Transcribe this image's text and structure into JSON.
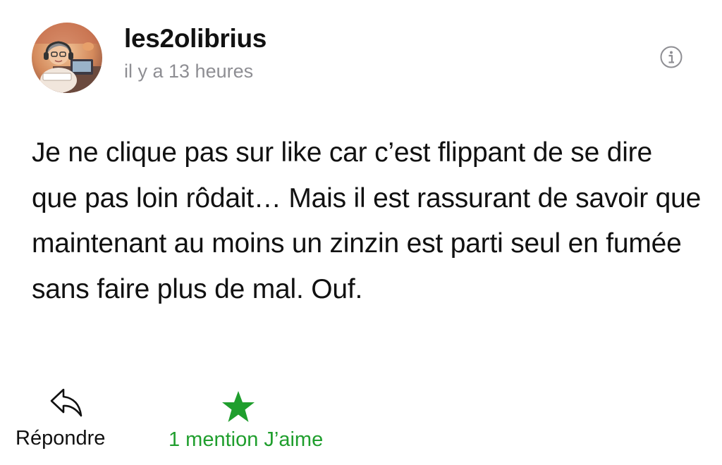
{
  "comment": {
    "username": "les2olibrius",
    "timestamp": "il y a 13 heures",
    "text": "Je ne clique pas sur like car c’est flippant de se dire que pas loin rôdait… Mais il est rassurant de savoir que maintenant au moins un zinzin est parti seul en fumée sans faire plus de mal. Ouf.",
    "avatar_icon": "bitmoji-avatar",
    "info_icon": "info-circle-icon"
  },
  "actions": {
    "reply_label": "Répondre",
    "reply_icon": "reply-arrow-icon",
    "like_label": "1 mention J’aime",
    "like_icon": "star-icon"
  },
  "colors": {
    "username": "#111111",
    "timestamp": "#8e8e93",
    "like_accent": "#1f9e2d",
    "info_icon": "#8e8e93"
  }
}
